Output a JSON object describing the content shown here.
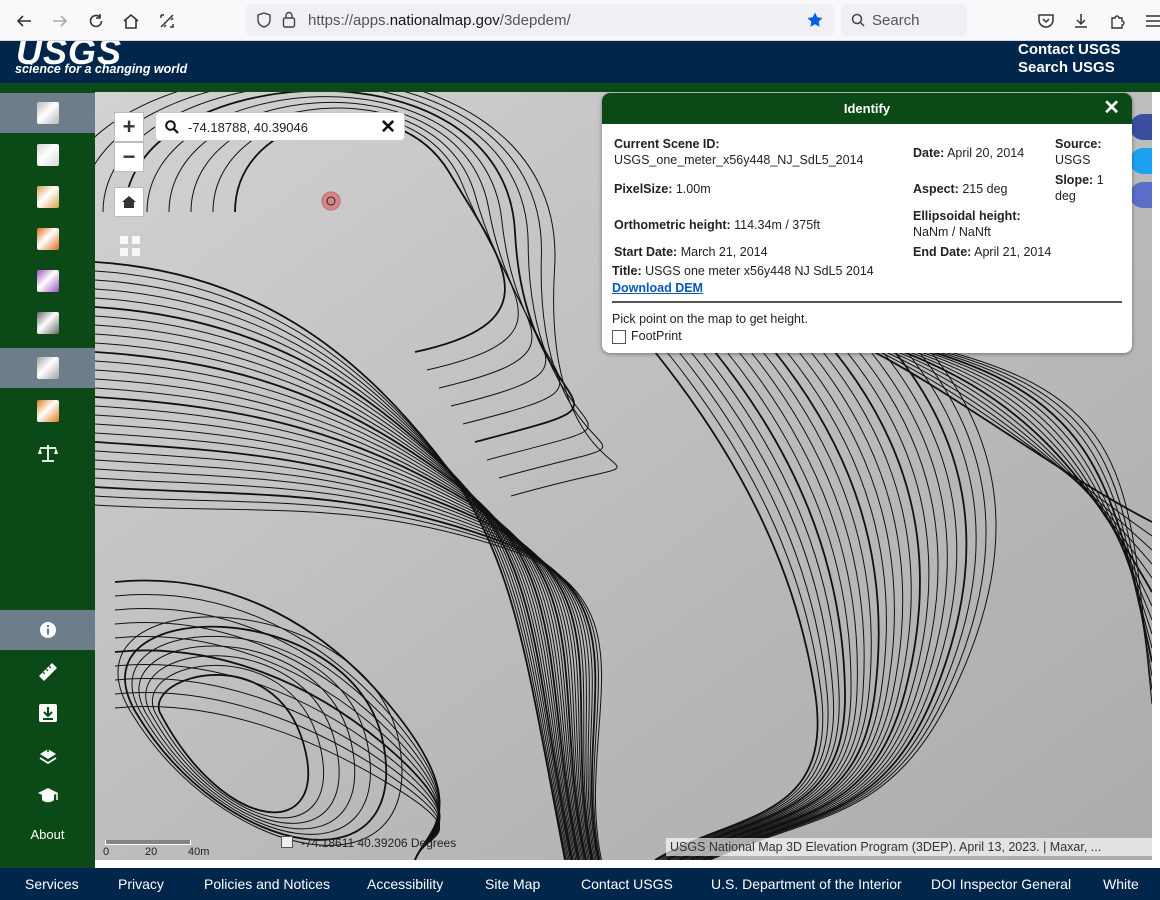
{
  "browser": {
    "url_prefix": "https://apps.",
    "url_host": "nationalmap.gov",
    "url_path": "/3depdem/",
    "search_placeholder": "Search"
  },
  "header": {
    "logo": "USGS",
    "tagline": "science for a changing world",
    "links": [
      "Contact USGS",
      "Search USGS"
    ]
  },
  "sidebar": {
    "layers": [
      {
        "name": "hillshade-gray",
        "color": "#b8b8b8",
        "active": true
      },
      {
        "name": "hillshade-multidirectional",
        "color": "#d6d6d6",
        "active": false
      },
      {
        "name": "aspect-map",
        "color": "#d9a050",
        "active": false
      },
      {
        "name": "tinted-hillshade",
        "color": "#e06a1e",
        "active": false
      },
      {
        "name": "elevation-tinted",
        "color": "#a050c0",
        "active": false
      },
      {
        "name": "slope-map",
        "color": "#666666",
        "active": false
      },
      {
        "name": "contour-map",
        "color": "#a0a0a0",
        "active": true
      },
      {
        "name": "slope-degrees",
        "color": "#e07a20",
        "active": false
      }
    ],
    "about_label": "About"
  },
  "map": {
    "search_value": "-74.18788, 40.39046",
    "scale_min": "0",
    "scale_mid": "20",
    "scale_max": "40m",
    "coordinates": "-74.18611  40.39206 Degrees",
    "attribution": "USGS National Map 3D Elevation Program (3DEP). April 13, 2023. | Maxar, ..."
  },
  "identify": {
    "title": "Identify",
    "scene_id_label": "Current Scene ID:",
    "scene_id_value": "USGS_one_meter_x56y448_NJ_SdL5_2014",
    "date_label": "Date:",
    "date_value": "April 20, 2014",
    "source_label": "Source:",
    "source_value": "USGS",
    "pixelsize_label": "PixelSize:",
    "pixelsize_value": "1.00m",
    "aspect_label": "Aspect:",
    "aspect_value": "215 deg",
    "slope_label": "Slope:",
    "slope_value": "1",
    "slope_unit": "deg",
    "ortho_label": "Orthometric height:",
    "ortho_value": "114.34m / 375ft",
    "ellipsoidal_label": "Ellipsoidal height:",
    "ellipsoidal_value": "NaNm / NaNft",
    "start_label": "Start Date:",
    "start_value": "March 21, 2014",
    "end_label": "End Date:",
    "end_value": "April 21, 2014",
    "title_label": "Title:",
    "title_value": "USGS one meter x56y448 NJ SdL5 2014",
    "download_label": "Download DEM",
    "instruction": "Pick point on the map to get height.",
    "footprint_label": "FootPrint"
  },
  "footer": {
    "links": [
      "Services",
      "Privacy",
      "Policies and Notices",
      "Accessibility",
      "Site Map",
      "Contact USGS",
      "U.S. Department of the Interior",
      "DOI Inspector General",
      "White"
    ]
  }
}
